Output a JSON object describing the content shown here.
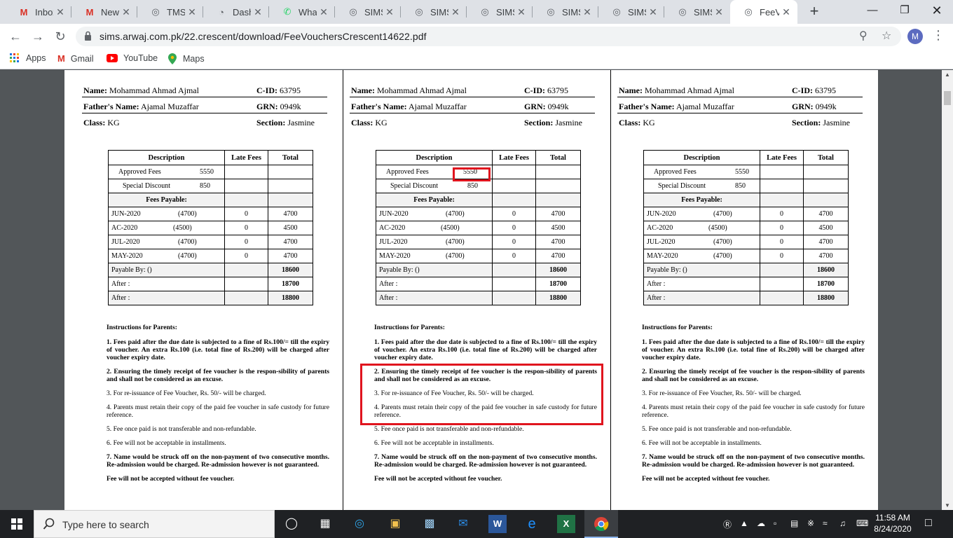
{
  "browser": {
    "tabs": [
      {
        "title": "Inbox",
        "icon": "gmail-icon",
        "color": "#d93025"
      },
      {
        "title": "New M",
        "icon": "gmail-icon",
        "color": "#d93025"
      },
      {
        "title": "TMS",
        "icon": "globe-icon",
        "color": "#5f6368"
      },
      {
        "title": "Dashb",
        "icon": "dashboard-icon",
        "color": "#5f6368"
      },
      {
        "title": "What",
        "icon": "whatsapp-icon",
        "color": "#25d366"
      },
      {
        "title": "SIMS",
        "icon": "globe-icon",
        "color": "#5f6368"
      },
      {
        "title": "SIMS",
        "icon": "globe-icon",
        "color": "#5f6368"
      },
      {
        "title": "SIMS",
        "icon": "globe-icon",
        "color": "#5f6368"
      },
      {
        "title": "SIMS",
        "icon": "globe-icon",
        "color": "#5f6368"
      },
      {
        "title": "SIMS",
        "icon": "globe-icon",
        "color": "#5f6368"
      },
      {
        "title": "SIMS",
        "icon": "globe-icon",
        "color": "#5f6368"
      },
      {
        "title": "FeeVo",
        "icon": "globe-icon",
        "color": "#5f6368",
        "active": true
      }
    ],
    "url": "sims.arwaj.com.pk/22.crescent/download/FeeVouchersCrescent14622.pdf",
    "profile_initial": "M",
    "bookmarks": [
      {
        "label": "Apps",
        "icon": "apps-grid-icon"
      },
      {
        "label": "Gmail",
        "icon": "gmail-icon"
      },
      {
        "label": "YouTube",
        "icon": "youtube-icon"
      },
      {
        "label": "Maps",
        "icon": "maps-pin-icon"
      }
    ]
  },
  "voucher": {
    "name_label": "Name:",
    "name": "Mohammad Ahmad Ajmal",
    "cid_label": "C-ID:",
    "cid": "63795",
    "father_label": "Father's Name:",
    "father": "Ajamal Muzaffar",
    "grn_label": "GRN:",
    "grn": "0949k",
    "class_label": "Class:",
    "class": "KG",
    "section_label": "Section:",
    "section": "Jasmine",
    "table": {
      "headers": [
        "Description",
        "Late Fees",
        "Total"
      ],
      "approved_label": "Approved Fees",
      "approved_value": "5550",
      "discount_label": "Special Discount",
      "discount_value": "850",
      "payable_header": "Fees Payable:",
      "months": [
        {
          "month": "JUN-2020",
          "amount": "(4700)",
          "late": "0",
          "total": "4700"
        },
        {
          "month": "AC-2020",
          "amount": "(4500)",
          "late": "0",
          "total": "4500"
        },
        {
          "month": "JUL-2020",
          "amount": "(4700)",
          "late": "0",
          "total": "4700"
        },
        {
          "month": "MAY-2020",
          "amount": "(4700)",
          "late": "0",
          "total": "4700"
        }
      ],
      "payable_by_label": "Payable By: ()",
      "payable_by_total": "18600",
      "after1_label": "After :",
      "after1_total": "18700",
      "after2_label": "After :",
      "after2_total": "18800"
    },
    "instructions_title": "Instructions for Parents:",
    "instructions": [
      "1.  Fees paid after the due date is subjected to a fine of Rs.100/= till the expiry of voucher. An extra Rs.100 (i.e. total fine of Rs.200) will be charged after voucher expiry date.",
      "2. Ensuring the timely receipt of fee voucher is the respon-sibility of parents and shall not be considered as an excuse.",
      "3. For re-issuance of Fee Voucher, Rs. 50/- will be charged.",
      "4.  Parents must retain their copy of the paid fee voucher in safe custody for future reference.",
      "5. Fee once paid is not transferable and non-refundable.",
      "6. Fee will not be acceptable in installments.",
      "7.  Name would be struck off on the non-payment of two consecutive months.  Re-admission would be charged.  Re-admission however is not guaranteed.",
      "Fee will not be accepted without fee voucher."
    ]
  },
  "taskbar": {
    "search_placeholder": "Type here to search",
    "time": "11:58 AM",
    "date": "8/24/2020"
  }
}
